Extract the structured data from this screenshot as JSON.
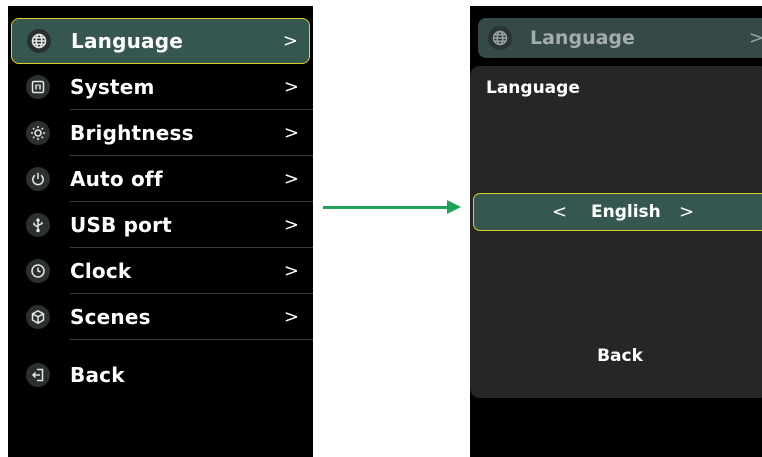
{
  "left_menu": {
    "items": [
      {
        "label": "Language",
        "chevron": ">",
        "icon": "globe-icon"
      },
      {
        "label": "System",
        "chevron": ">",
        "icon": "system-icon"
      },
      {
        "label": "Brightness",
        "chevron": ">",
        "icon": "sun-icon"
      },
      {
        "label": "Auto off",
        "chevron": ">",
        "icon": "power-icon"
      },
      {
        "label": "USB port",
        "chevron": ">",
        "icon": "usb-icon"
      },
      {
        "label": "Clock",
        "chevron": ">",
        "icon": "clock-icon"
      },
      {
        "label": "Scenes",
        "chevron": ">",
        "icon": "cube-icon"
      },
      {
        "label": "Back",
        "icon": "exit-icon"
      }
    ],
    "selected_index": 0
  },
  "right_screen": {
    "top_row": {
      "label": "Language",
      "chevron": ">",
      "icon": "globe-icon"
    },
    "panel": {
      "title": "Language",
      "selector": {
        "left_arrow": "<",
        "value": "English",
        "right_arrow": ">"
      },
      "back_label": "Back"
    }
  },
  "colors": {
    "selected_bg": "#35574f",
    "highlight_border": "#d6d22b",
    "arrow": "#1fa25a",
    "screen_bg": "#000000",
    "panel_bg": "#262626"
  }
}
